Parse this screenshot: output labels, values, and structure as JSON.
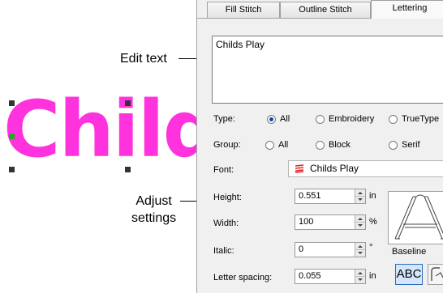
{
  "preview": {
    "text": "Child"
  },
  "callouts": {
    "edit_text": "Edit text",
    "adjust_settings": "Adjust\nsettings"
  },
  "tabs": [
    {
      "label": "Fill Stitch",
      "active": false
    },
    {
      "label": "Outline Stitch",
      "active": false
    },
    {
      "label": "Lettering",
      "active": true
    }
  ],
  "text_input": {
    "value": "Childs Play"
  },
  "type_row": {
    "label": "Type:",
    "options": [
      {
        "label": "All",
        "selected": true
      },
      {
        "label": "Embroidery",
        "selected": false
      },
      {
        "label": "TrueType",
        "selected": false
      }
    ]
  },
  "group_row": {
    "label": "Group:",
    "options": [
      {
        "label": "All",
        "selected": false
      },
      {
        "label": "Block",
        "selected": false
      },
      {
        "label": "Serif",
        "selected": false
      }
    ]
  },
  "font": {
    "label": "Font:",
    "value": "Childs Play",
    "icon": "embroidery-font-icon"
  },
  "fields": {
    "height": {
      "label": "Height:",
      "value": "0.551",
      "unit": "in"
    },
    "width": {
      "label": "Width:",
      "value": "100",
      "unit": "%"
    },
    "italic": {
      "label": "Italic:",
      "value": "0",
      "unit": "°"
    },
    "letter_spacing": {
      "label": "Letter spacing:",
      "value": "0.055",
      "unit": "in"
    }
  },
  "baseline": {
    "label": "Baseline",
    "abc_label": "ABC"
  },
  "colors": {
    "stitch": "#ff33dd",
    "accent": "#2c6bbf",
    "handle": "#333333",
    "handle_active": "#22aa22"
  }
}
